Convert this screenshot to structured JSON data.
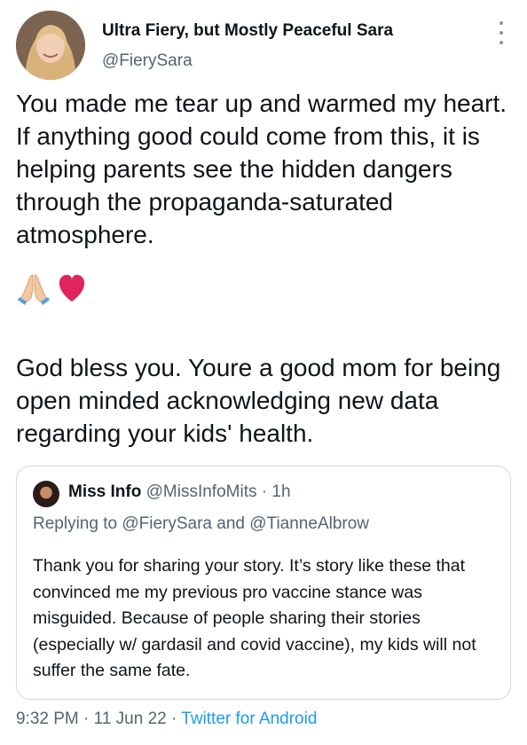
{
  "author": {
    "name": "Ultra Fiery, but Mostly Peaceful Sara",
    "handle": "@FierySara"
  },
  "tweet": {
    "paragraph1": "You made me tear up and warmed my heart. If anything good could come from this, it is helping parents see the hidden dangers through the propaganda-saturated atmosphere.",
    "emojis": [
      "folded-hands-emoji",
      "red-heart-emoji"
    ],
    "paragraph2": "God bless you. Youre a good mom for being open minded acknowledging new data regarding your kids' health."
  },
  "quoted": {
    "name": "Miss Info",
    "handle": "@MissInfoMits",
    "separator": " · ",
    "time": "1h",
    "replying_prefix": "Replying to ",
    "reply_to_1": "@FierySara",
    "reply_joiner": " and ",
    "reply_to_2": "@TianneAlbrow",
    "text": "Thank you for sharing your story. It’s story like these that convinced me my previous pro vaccine stance was misguided. Because of people sharing their stories (especially w/ gardasil and covid vaccine), my kids will not suffer the same fate."
  },
  "footer": {
    "time": "9:32 PM",
    "sep1": " · ",
    "date": "11 Jun 22",
    "sep2": " · ",
    "source": "Twitter for Android"
  },
  "colors": {
    "text": "#0f1419",
    "muted": "#536471",
    "link": "#1d9bf0",
    "border": "#cfd9de",
    "heart": "#e0245e"
  }
}
